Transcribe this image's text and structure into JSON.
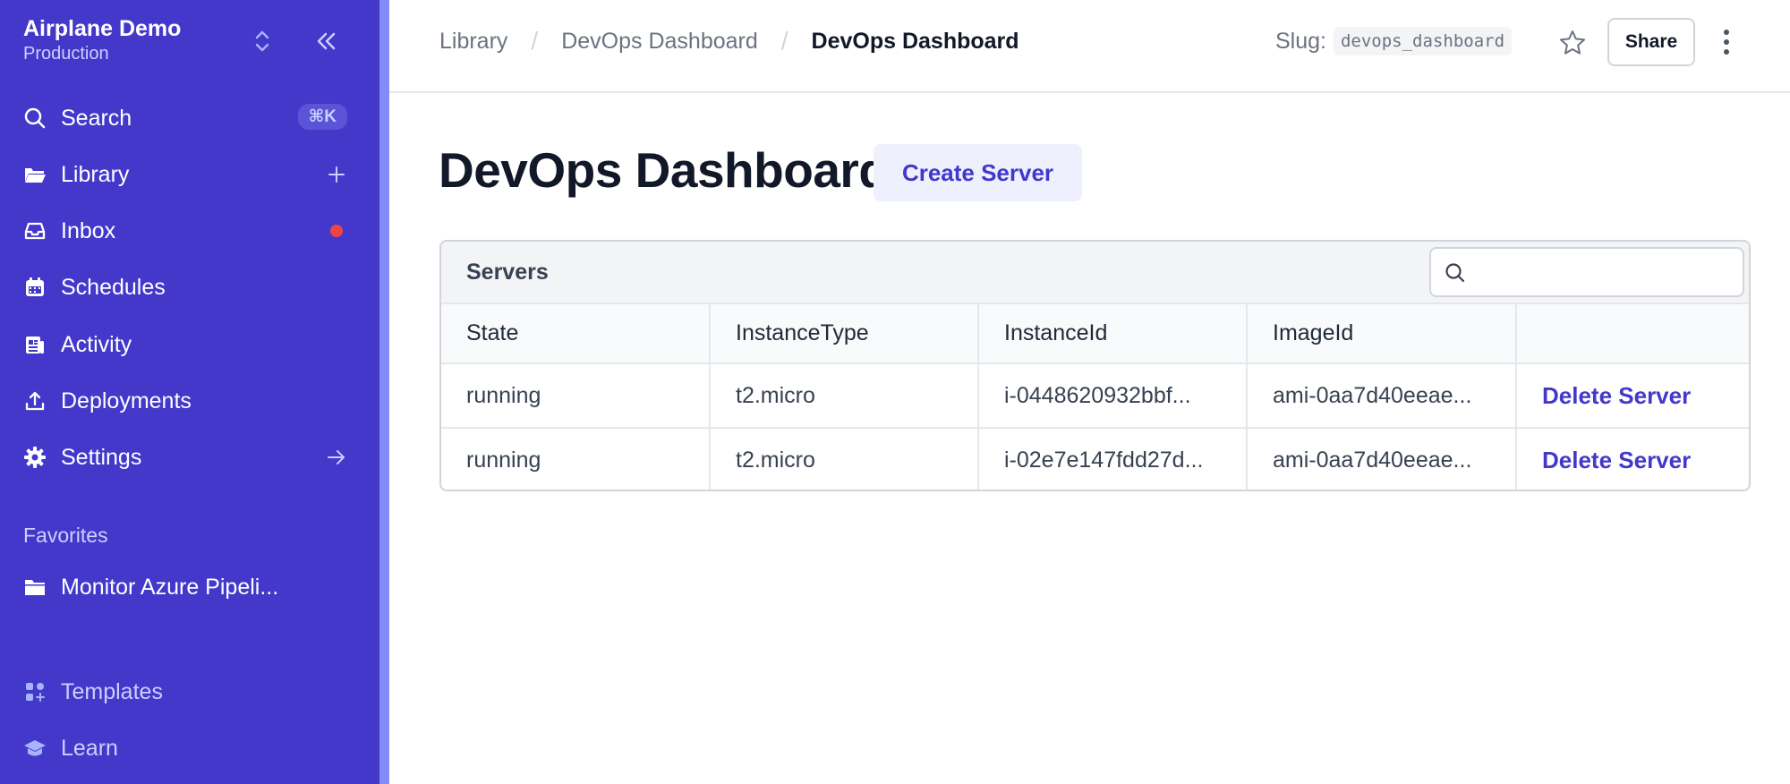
{
  "workspace": {
    "name": "Airplane Demo",
    "environment": "Production"
  },
  "sidebar": {
    "search": {
      "label": "Search",
      "shortcut": "⌘K"
    },
    "items": [
      {
        "label": "Library"
      },
      {
        "label": "Inbox"
      },
      {
        "label": "Schedules"
      },
      {
        "label": "Activity"
      },
      {
        "label": "Deployments"
      },
      {
        "label": "Settings"
      }
    ],
    "favorites_heading": "Favorites",
    "favorites": [
      {
        "label": "Monitor Azure Pipeli..."
      }
    ],
    "footer": [
      {
        "label": "Templates"
      },
      {
        "label": "Learn"
      }
    ]
  },
  "header": {
    "breadcrumbs": [
      "Library",
      "DevOps Dashboard",
      "DevOps Dashboard"
    ],
    "separator": "/",
    "slug_label": "Slug:",
    "slug_value": "devops_dashboard",
    "share_label": "Share"
  },
  "main": {
    "title": "DevOps Dashboard",
    "create_button": "Create Server",
    "table": {
      "title": "Servers",
      "search_placeholder": "",
      "columns": [
        "State",
        "InstanceType",
        "InstanceId",
        "ImageId",
        ""
      ],
      "rows": [
        {
          "state": "running",
          "instance_type": "t2.micro",
          "instance_id": "i-0448620932bbf...",
          "image_id": "ami-0aa7d40eeae...",
          "action": "Delete Server"
        },
        {
          "state": "running",
          "instance_type": "t2.micro",
          "instance_id": "i-02e7e147fdd27d...",
          "image_id": "ami-0aa7d40eeae...",
          "action": "Delete Server"
        }
      ]
    }
  },
  "colors": {
    "sidebar": "#4338ca",
    "accent": "#4338ca",
    "notification": "#ef4444"
  }
}
